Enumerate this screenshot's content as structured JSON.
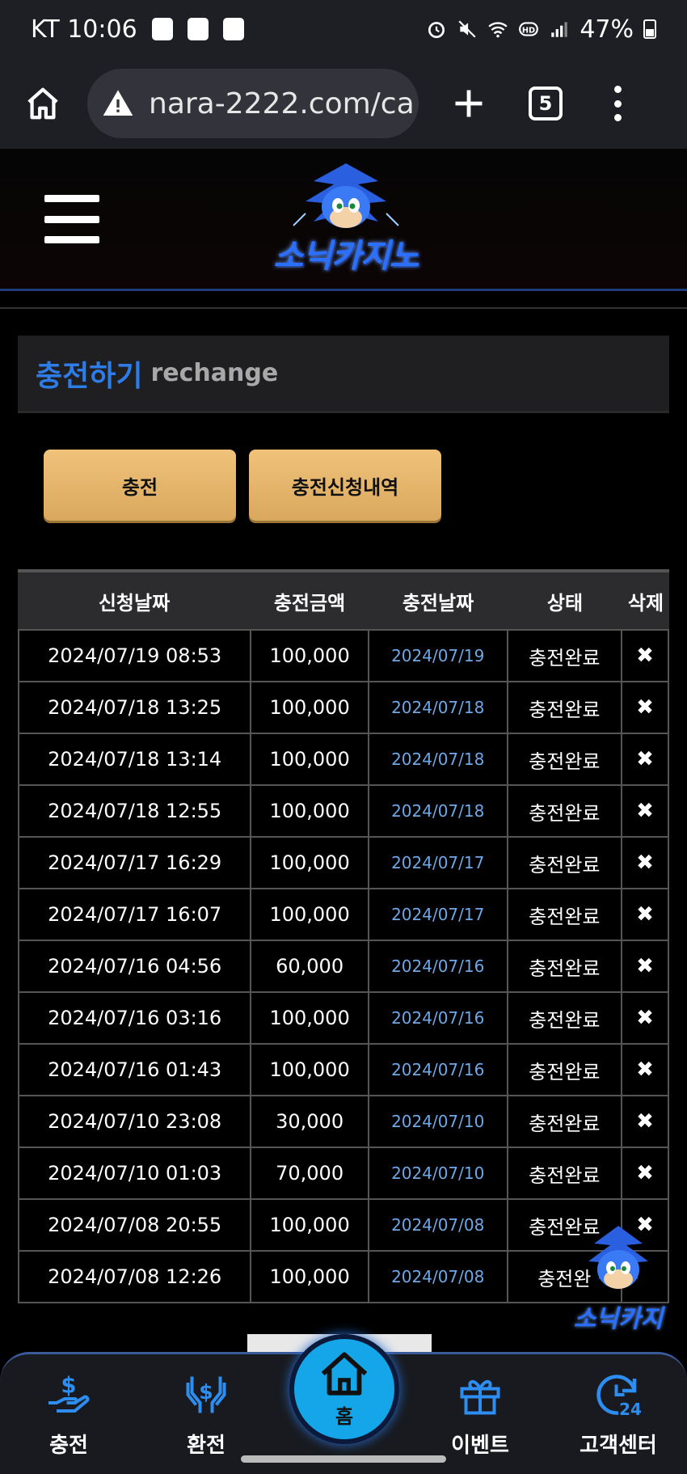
{
  "status_bar": {
    "carrier_time": "KT 10:06",
    "battery": "47%"
  },
  "browser": {
    "url": "nara-2222.com/ca",
    "tab_count": "5"
  },
  "site": {
    "logo_text": "소닉카지노"
  },
  "section": {
    "title": "충전하기",
    "subtitle": "rechange"
  },
  "buttons": {
    "charge": "충전",
    "history": "충전신청내역"
  },
  "table": {
    "headers": [
      "신청날짜",
      "충전금액",
      "충전날짜",
      "상태",
      "삭제"
    ],
    "rows": [
      [
        "2024/07/19 08:53",
        "100,000",
        "2024/07/19",
        "충전완료",
        "✖"
      ],
      [
        "2024/07/18 13:25",
        "100,000",
        "2024/07/18",
        "충전완료",
        "✖"
      ],
      [
        "2024/07/18 13:14",
        "100,000",
        "2024/07/18",
        "충전완료",
        "✖"
      ],
      [
        "2024/07/18 12:55",
        "100,000",
        "2024/07/18",
        "충전완료",
        "✖"
      ],
      [
        "2024/07/17 16:29",
        "100,000",
        "2024/07/17",
        "충전완료",
        "✖"
      ],
      [
        "2024/07/17 16:07",
        "100,000",
        "2024/07/17",
        "충전완료",
        "✖"
      ],
      [
        "2024/07/16 04:56",
        "60,000",
        "2024/07/16",
        "충전완료",
        "✖"
      ],
      [
        "2024/07/16 03:16",
        "100,000",
        "2024/07/16",
        "충전완료",
        "✖"
      ],
      [
        "2024/07/16 01:43",
        "100,000",
        "2024/07/16",
        "충전완료",
        "✖"
      ],
      [
        "2024/07/10 23:08",
        "30,000",
        "2024/07/10",
        "충전완료",
        "✖"
      ],
      [
        "2024/07/10 01:03",
        "70,000",
        "2024/07/10",
        "충전완료",
        "✖"
      ],
      [
        "2024/07/08 20:55",
        "100,000",
        "2024/07/08",
        "충전완료",
        "✖"
      ],
      [
        "2024/07/08 12:26",
        "100,000",
        "2024/07/08",
        "충전완",
        ""
      ]
    ]
  },
  "floating": {
    "text": "소닉카지"
  },
  "bottom_nav": {
    "charge": "충전",
    "exchange": "환전",
    "home": "홈",
    "event": "이벤트",
    "support": "고객센터"
  },
  "colors": {
    "accent_blue": "#2e7ce6",
    "button_gold": "#e6b366",
    "home_button": "#14a6e8"
  }
}
